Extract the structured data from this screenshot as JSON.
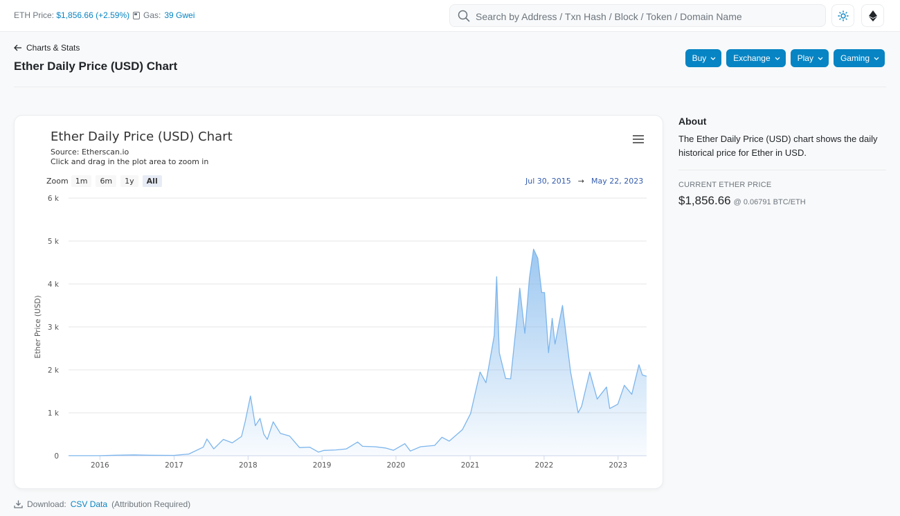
{
  "header": {
    "eth_price_label": "ETH Price:",
    "eth_price_value": "$1,856.66 (+2.59%)",
    "gas_label": "Gas:",
    "gas_value": "39 Gwei",
    "search_placeholder": "Search by Address / Txn Hash / Block / Token / Domain Name",
    "theme_icon": "sun-icon",
    "network_icon": "ethereum-icon"
  },
  "breadcrumb": {
    "back_label": "Charts & Stats"
  },
  "page_title": "Ether Daily Price (USD) Chart",
  "action_buttons": [
    "Buy",
    "Exchange",
    "Play",
    "Gaming"
  ],
  "chart_card": {
    "title": "Ether Daily Price (USD) Chart",
    "source": "Source: Etherscan.io",
    "hint": "Click and drag in the plot area to zoom in",
    "zoom_label": "Zoom",
    "zoom_options": [
      "1m",
      "6m",
      "1y",
      "All"
    ],
    "zoom_selected": "All",
    "range_from": "Jul 30, 2015",
    "range_arrow": "→",
    "range_to": "May 22, 2023"
  },
  "chart_data": {
    "type": "area",
    "title": "Ether Daily Price (USD) Chart",
    "ylabel": "Ether Price (USD)",
    "xlabel": "",
    "ylim": [
      0,
      6000
    ],
    "xlim": [
      "2015-07-30",
      "2023-05-22"
    ],
    "y_ticks": [
      0,
      1000,
      2000,
      3000,
      4000,
      5000,
      6000
    ],
    "y_tick_labels": [
      "0",
      "1 k",
      "2 k",
      "3 k",
      "4 k",
      "5 k",
      "6 k"
    ],
    "x_ticks": [
      "2016-01-01",
      "2017-01-01",
      "2018-01-01",
      "2019-01-01",
      "2020-01-01",
      "2021-01-01",
      "2022-01-01",
      "2023-01-01"
    ],
    "x_tick_labels": [
      "2016",
      "2017",
      "2018",
      "2019",
      "2020",
      "2021",
      "2022",
      "2023"
    ],
    "grid": true,
    "legend": false,
    "series_color": "#7cb5ec",
    "points": [
      [
        "2015-07-30",
        2
      ],
      [
        "2016-01-01",
        1
      ],
      [
        "2016-03-15",
        12
      ],
      [
        "2016-06-17",
        20
      ],
      [
        "2016-09-01",
        12
      ],
      [
        "2017-01-01",
        8
      ],
      [
        "2017-03-15",
        40
      ],
      [
        "2017-05-25",
        200
      ],
      [
        "2017-06-12",
        390
      ],
      [
        "2017-07-16",
        160
      ],
      [
        "2017-09-01",
        380
      ],
      [
        "2017-10-15",
        300
      ],
      [
        "2017-11-30",
        450
      ],
      [
        "2017-12-18",
        800
      ],
      [
        "2018-01-13",
        1390
      ],
      [
        "2018-02-06",
        700
      ],
      [
        "2018-03-01",
        870
      ],
      [
        "2018-03-20",
        500
      ],
      [
        "2018-04-06",
        380
      ],
      [
        "2018-05-05",
        790
      ],
      [
        "2018-06-10",
        520
      ],
      [
        "2018-07-25",
        460
      ],
      [
        "2018-09-12",
        190
      ],
      [
        "2018-11-01",
        200
      ],
      [
        "2018-12-14",
        85
      ],
      [
        "2019-01-10",
        125
      ],
      [
        "2019-03-10",
        135
      ],
      [
        "2019-05-01",
        160
      ],
      [
        "2019-06-26",
        320
      ],
      [
        "2019-07-20",
        220
      ],
      [
        "2019-09-20",
        210
      ],
      [
        "2019-11-10",
        180
      ],
      [
        "2019-12-20",
        128
      ],
      [
        "2020-02-14",
        280
      ],
      [
        "2020-03-12",
        110
      ],
      [
        "2020-05-01",
        210
      ],
      [
        "2020-07-10",
        240
      ],
      [
        "2020-08-15",
        430
      ],
      [
        "2020-09-20",
        340
      ],
      [
        "2020-11-24",
        610
      ],
      [
        "2021-01-03",
        980
      ],
      [
        "2021-02-19",
        1950
      ],
      [
        "2021-03-20",
        1700
      ],
      [
        "2021-04-30",
        2800
      ],
      [
        "2021-05-12",
        4170
      ],
      [
        "2021-05-25",
        2400
      ],
      [
        "2021-06-25",
        1800
      ],
      [
        "2021-07-20",
        1790
      ],
      [
        "2021-08-20",
        3200
      ],
      [
        "2021-09-03",
        3900
      ],
      [
        "2021-09-28",
        2850
      ],
      [
        "2021-10-21",
        4150
      ],
      [
        "2021-11-10",
        4810
      ],
      [
        "2021-12-01",
        4600
      ],
      [
        "2021-12-20",
        3800
      ],
      [
        "2022-01-03",
        3800
      ],
      [
        "2022-01-23",
        2400
      ],
      [
        "2022-02-10",
        3200
      ],
      [
        "2022-02-24",
        2600
      ],
      [
        "2022-04-02",
        3500
      ],
      [
        "2022-05-12",
        1950
      ],
      [
        "2022-06-18",
        1000
      ],
      [
        "2022-07-05",
        1150
      ],
      [
        "2022-08-14",
        1950
      ],
      [
        "2022-09-20",
        1320
      ],
      [
        "2022-11-05",
        1600
      ],
      [
        "2022-11-21",
        1100
      ],
      [
        "2022-12-31",
        1200
      ],
      [
        "2023-02-01",
        1640
      ],
      [
        "2023-03-10",
        1430
      ],
      [
        "2023-04-14",
        2120
      ],
      [
        "2023-05-01",
        1880
      ],
      [
        "2023-05-22",
        1850
      ]
    ]
  },
  "about": {
    "heading": "About",
    "text": "The Ether Daily Price (USD) chart shows the daily historical price for Ether in USD.",
    "current_label": "Current Ether Price",
    "current_value": "$1,856.66",
    "current_btc": "@ 0.06791 BTC/ETH"
  },
  "footer": {
    "download_label": "Download:",
    "download_link": "CSV Data",
    "attribution": "(Attribution Required)"
  }
}
